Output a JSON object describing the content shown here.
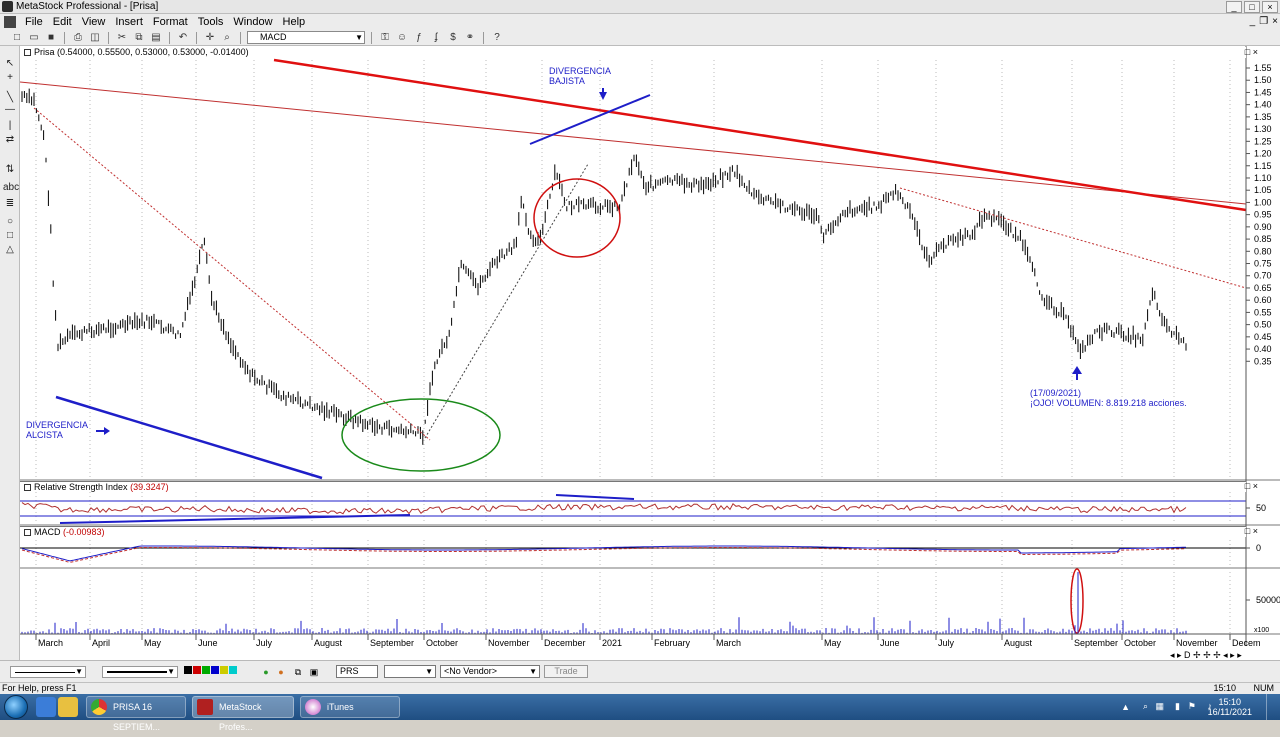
{
  "window": {
    "title": "MetaStock Professional - [Prisa]",
    "min": "_",
    "max": "□",
    "close": "×"
  },
  "menu": [
    "File",
    "Edit",
    "View",
    "Insert",
    "Format",
    "Tools",
    "Window",
    "Help"
  ],
  "toolbar": {
    "indicator_value": "MACD"
  },
  "price_pane": {
    "header": "Prisa (0.54000, 0.55500, 0.53000, 0.53000, -0.01400)",
    "y_ticks": [
      "1.55",
      "1.50",
      "1.45",
      "1.40",
      "1.35",
      "1.30",
      "1.25",
      "1.20",
      "1.15",
      "1.10",
      "1.05",
      "1.00",
      "0.95",
      "0.90",
      "0.85",
      "0.80",
      "0.75",
      "0.70",
      "0.65",
      "0.60",
      "0.55",
      "0.50",
      "0.45",
      "0.40",
      "0.35"
    ]
  },
  "rsi_pane": {
    "name": "Relative Strength Index",
    "value": "(39.3247)",
    "y_tick": "50"
  },
  "macd_pane": {
    "name": "MACD",
    "value": "(-0.00983)",
    "y_tick": "0"
  },
  "volume_pane": {
    "y_tick": "50000",
    "unit": "x100"
  },
  "x_axis": [
    "March",
    "April",
    "May",
    "June",
    "July",
    "August",
    "September",
    "October",
    "November",
    "December",
    "2021",
    "February",
    "March",
    "May",
    "June",
    "July",
    "August",
    "September",
    "October",
    "November",
    "Decem"
  ],
  "annotations": {
    "bearish_div": [
      "DIVERGENCIA",
      "BAJISTA"
    ],
    "bullish_div": [
      "DIVERGENCIA",
      "ALCISTA"
    ],
    "volume_note": [
      "(17/09/2021)",
      "¡OJO! VOLUMEN: 8.819.218 acciones."
    ]
  },
  "statusbar": {
    "symbol": "PRS",
    "vendor": "<No Vendor>",
    "trade": "Trade",
    "help": "For Help, press F1",
    "time": "15:10",
    "num": "NUM"
  },
  "taskbar": {
    "tasks": [
      "PRISA 16 SEPTIEM...",
      "MetaStock Profes...",
      "iTunes"
    ],
    "clock_time": "15:10",
    "clock_date": "16/11/2021"
  },
  "colors": {
    "red_trend": "#e01010",
    "blue_line": "#1e1ec8",
    "green_circle": "#1a8a1a",
    "rsi_line": "#b03030"
  }
}
